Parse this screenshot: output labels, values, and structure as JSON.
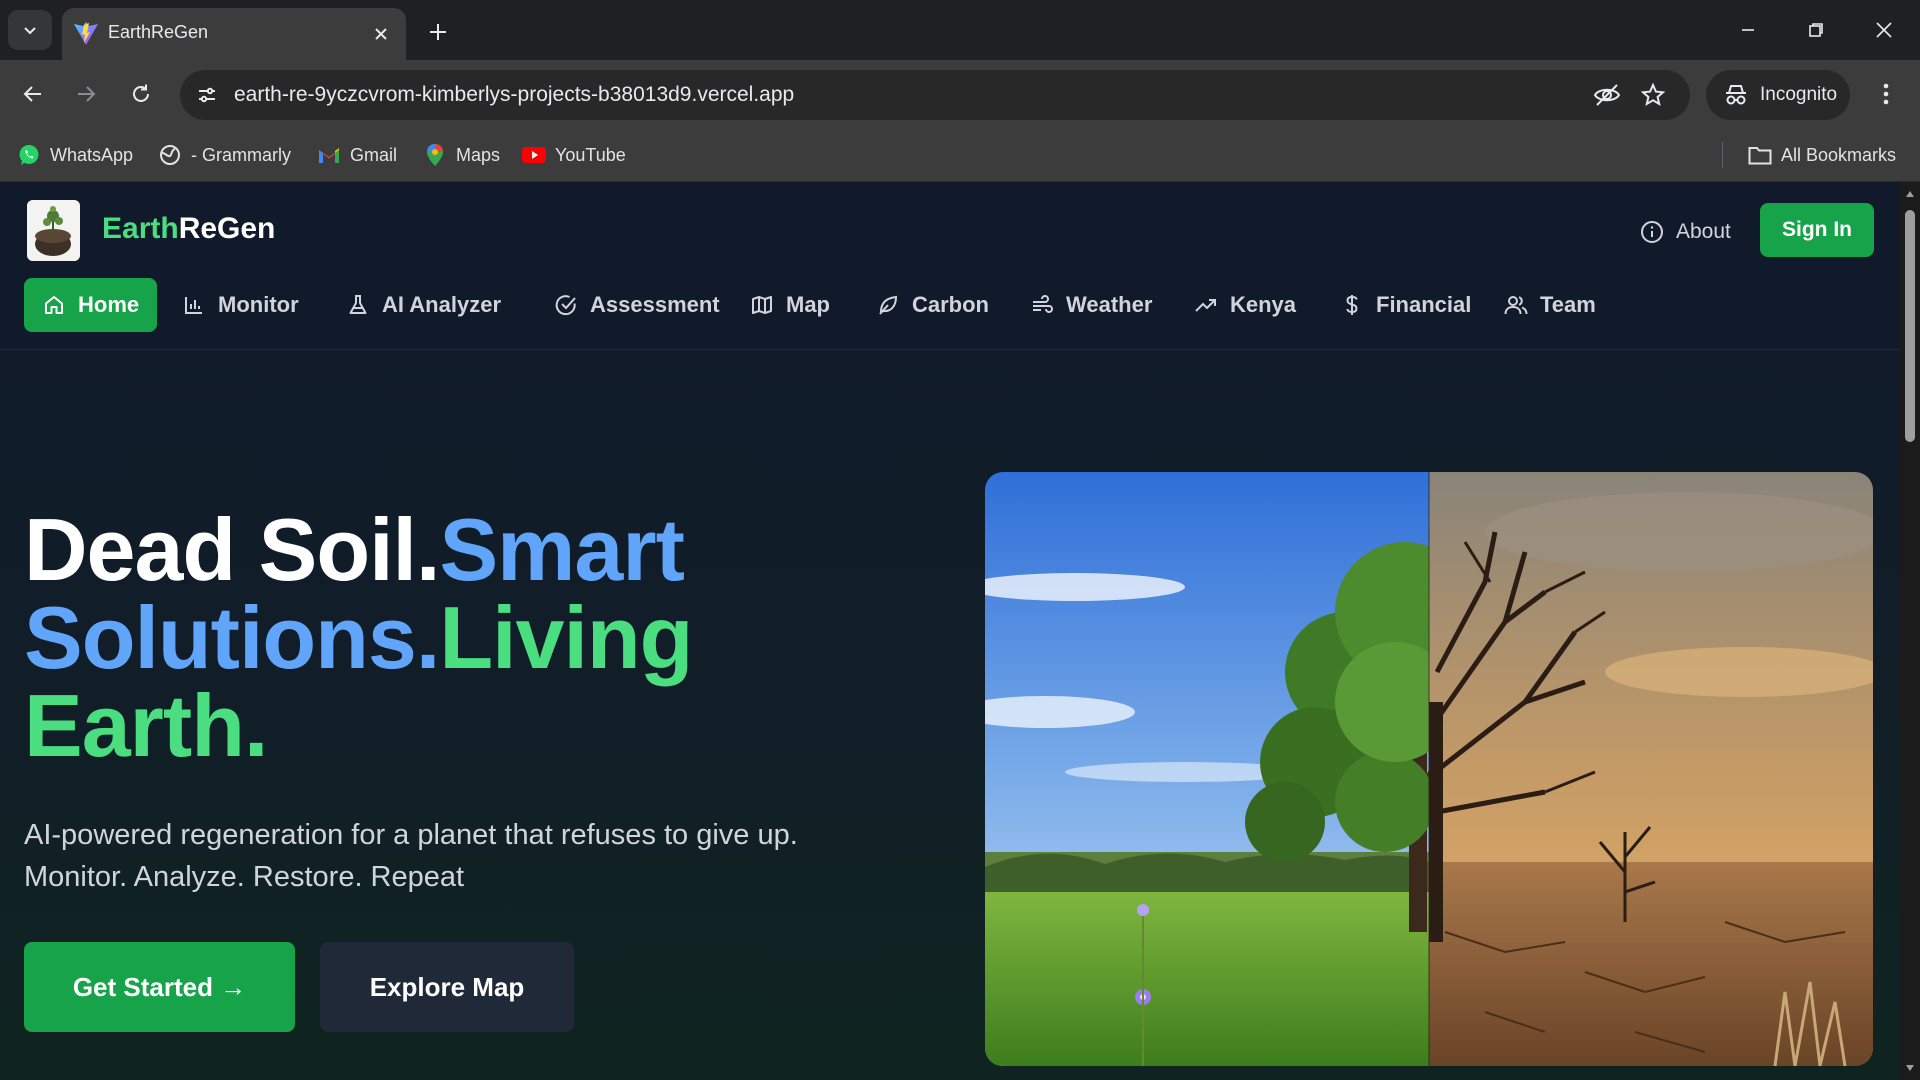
{
  "browser": {
    "tab_title": "EarthReGen",
    "url": "earth-re-9yczcvrom-kimberlys-projects-b38013d9.vercel.app",
    "incognito_label": "Incognito",
    "bookmarks": [
      "WhatsApp",
      "- Grammarly",
      "Gmail",
      "Maps",
      "YouTube"
    ],
    "all_bookmarks_label": "All Bookmarks"
  },
  "header": {
    "brand_part1": "Earth",
    "brand_part2": "ReGen",
    "about_label": "About",
    "signin_label": "Sign In"
  },
  "nav": {
    "items": [
      {
        "label": "Home",
        "icon": "home-icon"
      },
      {
        "label": "Monitor",
        "icon": "bar-chart-icon"
      },
      {
        "label": "AI Analyzer",
        "icon": "flask-icon"
      },
      {
        "label": "Assessment",
        "icon": "check-circle-icon"
      },
      {
        "label": "Map",
        "icon": "map-icon"
      },
      {
        "label": "Carbon",
        "icon": "leaf-icon"
      },
      {
        "label": "Weather",
        "icon": "wind-icon"
      },
      {
        "label": "Kenya",
        "icon": "trending-up-icon"
      },
      {
        "label": "Financial",
        "icon": "dollar-icon"
      },
      {
        "label": "Team",
        "icon": "users-icon"
      }
    ],
    "active": "Home"
  },
  "hero": {
    "line1_a": "Dead Soil.",
    "line1_b": "Smart",
    "line2_a": "Solutions.",
    "line2_b": "Living",
    "line3": "Earth.",
    "subtitle_line1": "AI-powered regeneration for a planet that refuses to give up.",
    "subtitle_line2": "Monitor. Analyze. Restore. Repeat",
    "primary_button": "Get Started →",
    "secondary_button": "Explore Map"
  },
  "colors": {
    "accent_green": "#16a34a",
    "brand_green": "#4ade80",
    "brand_blue": "#60a5fa",
    "page_bg": "#111a2a"
  }
}
